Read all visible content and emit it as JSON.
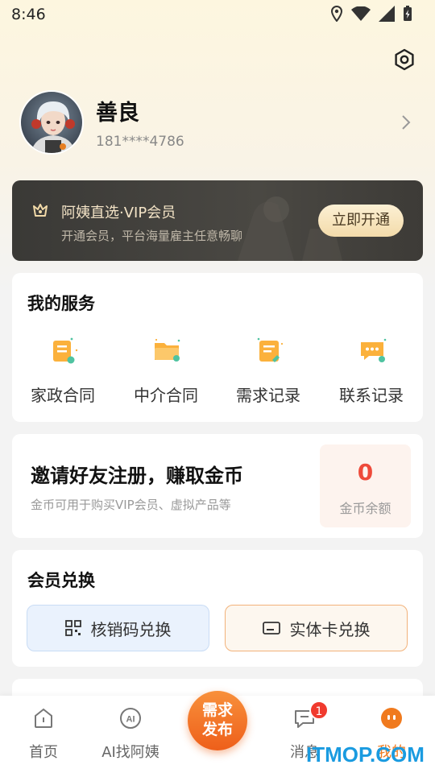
{
  "status_bar": {
    "time": "8:46"
  },
  "profile": {
    "name": "善良",
    "phone": "181****4786"
  },
  "vip": {
    "title": "阿姨直选·VIP会员",
    "subtitle": "开通会员，平台海量雇主任意畅聊",
    "button": "立即开通"
  },
  "services": {
    "title": "我的服务",
    "items": [
      {
        "label": "家政合同",
        "icon": "contract-icon"
      },
      {
        "label": "中介合同",
        "icon": "folder-icon"
      },
      {
        "label": "需求记录",
        "icon": "scroll-icon"
      },
      {
        "label": "联系记录",
        "icon": "chat-bubble-icon"
      }
    ]
  },
  "invite": {
    "title": "邀请好友注册，赚取金币",
    "subtitle": "金币可用于购买VIP会员、虚拟产品等",
    "coin_value": "0",
    "coin_label": "金币余额"
  },
  "redeem": {
    "title": "会员兑换",
    "code_button": "核销码兑换",
    "card_button": "实体卡兑换"
  },
  "tabs": [
    {
      "label": "首页",
      "icon": "home-icon"
    },
    {
      "label": "AI找阿姨",
      "icon": "ai-icon"
    },
    {
      "label": "需求发布",
      "icon": "publish-button"
    },
    {
      "label": "消息",
      "icon": "message-icon",
      "badge": "1"
    },
    {
      "label": "我的",
      "icon": "profile-icon",
      "active": true
    }
  ],
  "publish": {
    "line1": "需求",
    "line2": "发布"
  },
  "watermark": "ITMOP.COM",
  "colors": {
    "accent": "#f07a1e",
    "coin": "#ee4a3a",
    "vip_bg": "#3a3936"
  }
}
